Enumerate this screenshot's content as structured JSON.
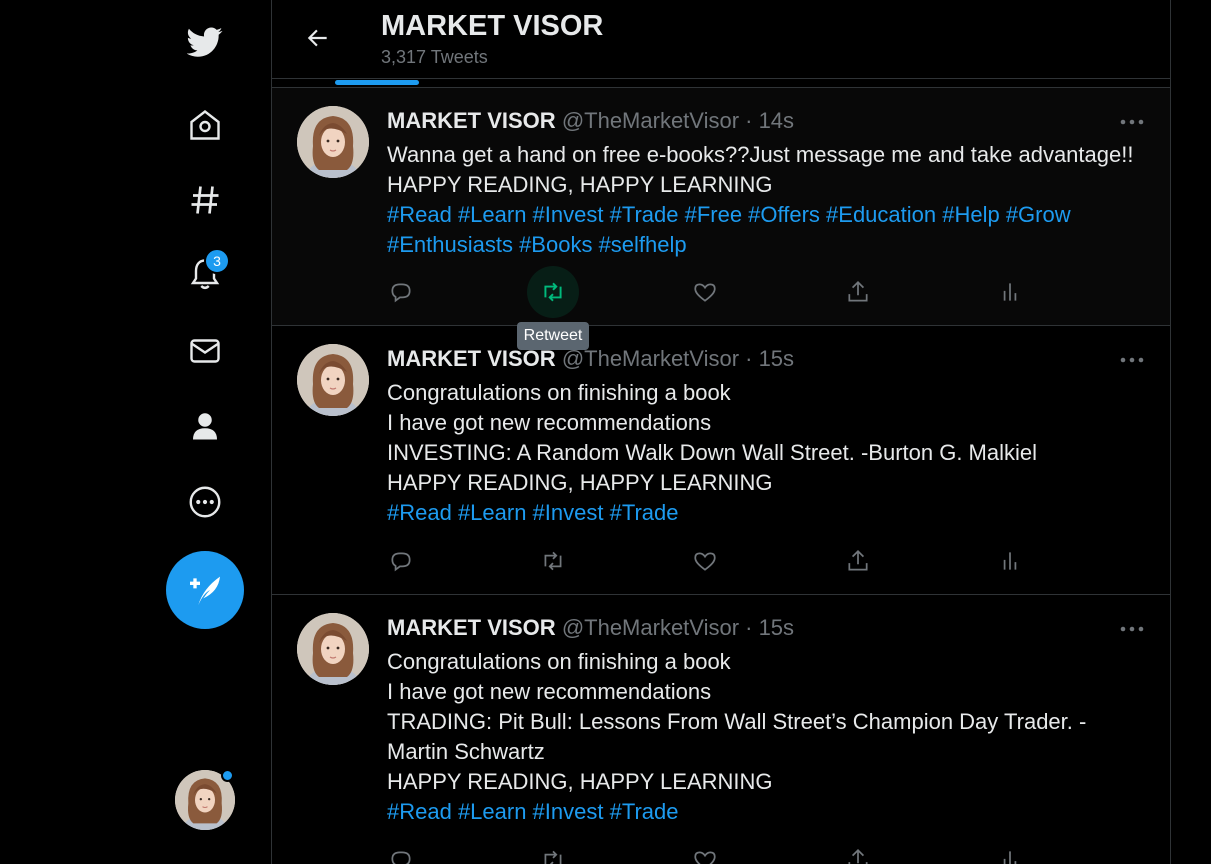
{
  "header": {
    "title": "MARKET VISOR",
    "tweet_count": "3,317 Tweets"
  },
  "nav": {
    "notification_count": "3"
  },
  "tooltip": "Retweet",
  "tweets": [
    {
      "name": "MARKET VISOR",
      "handle_time": "@TheMarketVisor · 14s",
      "lines": [
        "Wanna get a hand on free e-books??Just message me and take advantage!!",
        "HAPPY READING, HAPPY LEARNING"
      ],
      "tags": [
        "#Read #Learn #Invest #Trade #Free #Offers #Education #Help #Grow",
        "#Enthusiasts #Books #selfhelp"
      ]
    },
    {
      "name": "MARKET VISOR",
      "handle_time": "@TheMarketVisor · 15s",
      "lines": [
        "Congratulations on finishing a book",
        "I have got new recommendations",
        "INVESTING: A Random Walk Down Wall Street. -Burton G. Malkiel",
        "HAPPY READING, HAPPY LEARNING"
      ],
      "tags": [
        "#Read #Learn #Invest #Trade"
      ]
    },
    {
      "name": "MARKET VISOR",
      "handle_time": "@TheMarketVisor · 15s",
      "lines": [
        "Congratulations on finishing a book",
        "I have got new recommendations",
        "TRADING: Pit Bull: Lessons From Wall Street’s Champion Day Trader. -",
        "Martin Schwartz",
        "HAPPY READING, HAPPY LEARNING"
      ],
      "tags": [
        "#Read #Learn #Invest #Trade"
      ]
    }
  ],
  "colors": {
    "accent": "#1d9bf0",
    "retweet_active": "#00ba7c",
    "muted": "#71767b",
    "text": "#e7e9ea",
    "border": "#2f3336"
  },
  "icons": {
    "logo": "twitter-bird-icon",
    "home": "home-icon",
    "explore": "hashtag-icon",
    "notifications": "bell-icon",
    "messages": "envelope-icon",
    "profile": "person-icon",
    "more": "more-circle-icon",
    "compose": "compose-feather-icon",
    "back": "back-arrow-icon",
    "reply": "reply-icon",
    "retweet": "retweet-icon",
    "like": "heart-icon",
    "share": "share-icon",
    "analytics": "analytics-icon",
    "tweet_more": "ellipsis-icon"
  }
}
